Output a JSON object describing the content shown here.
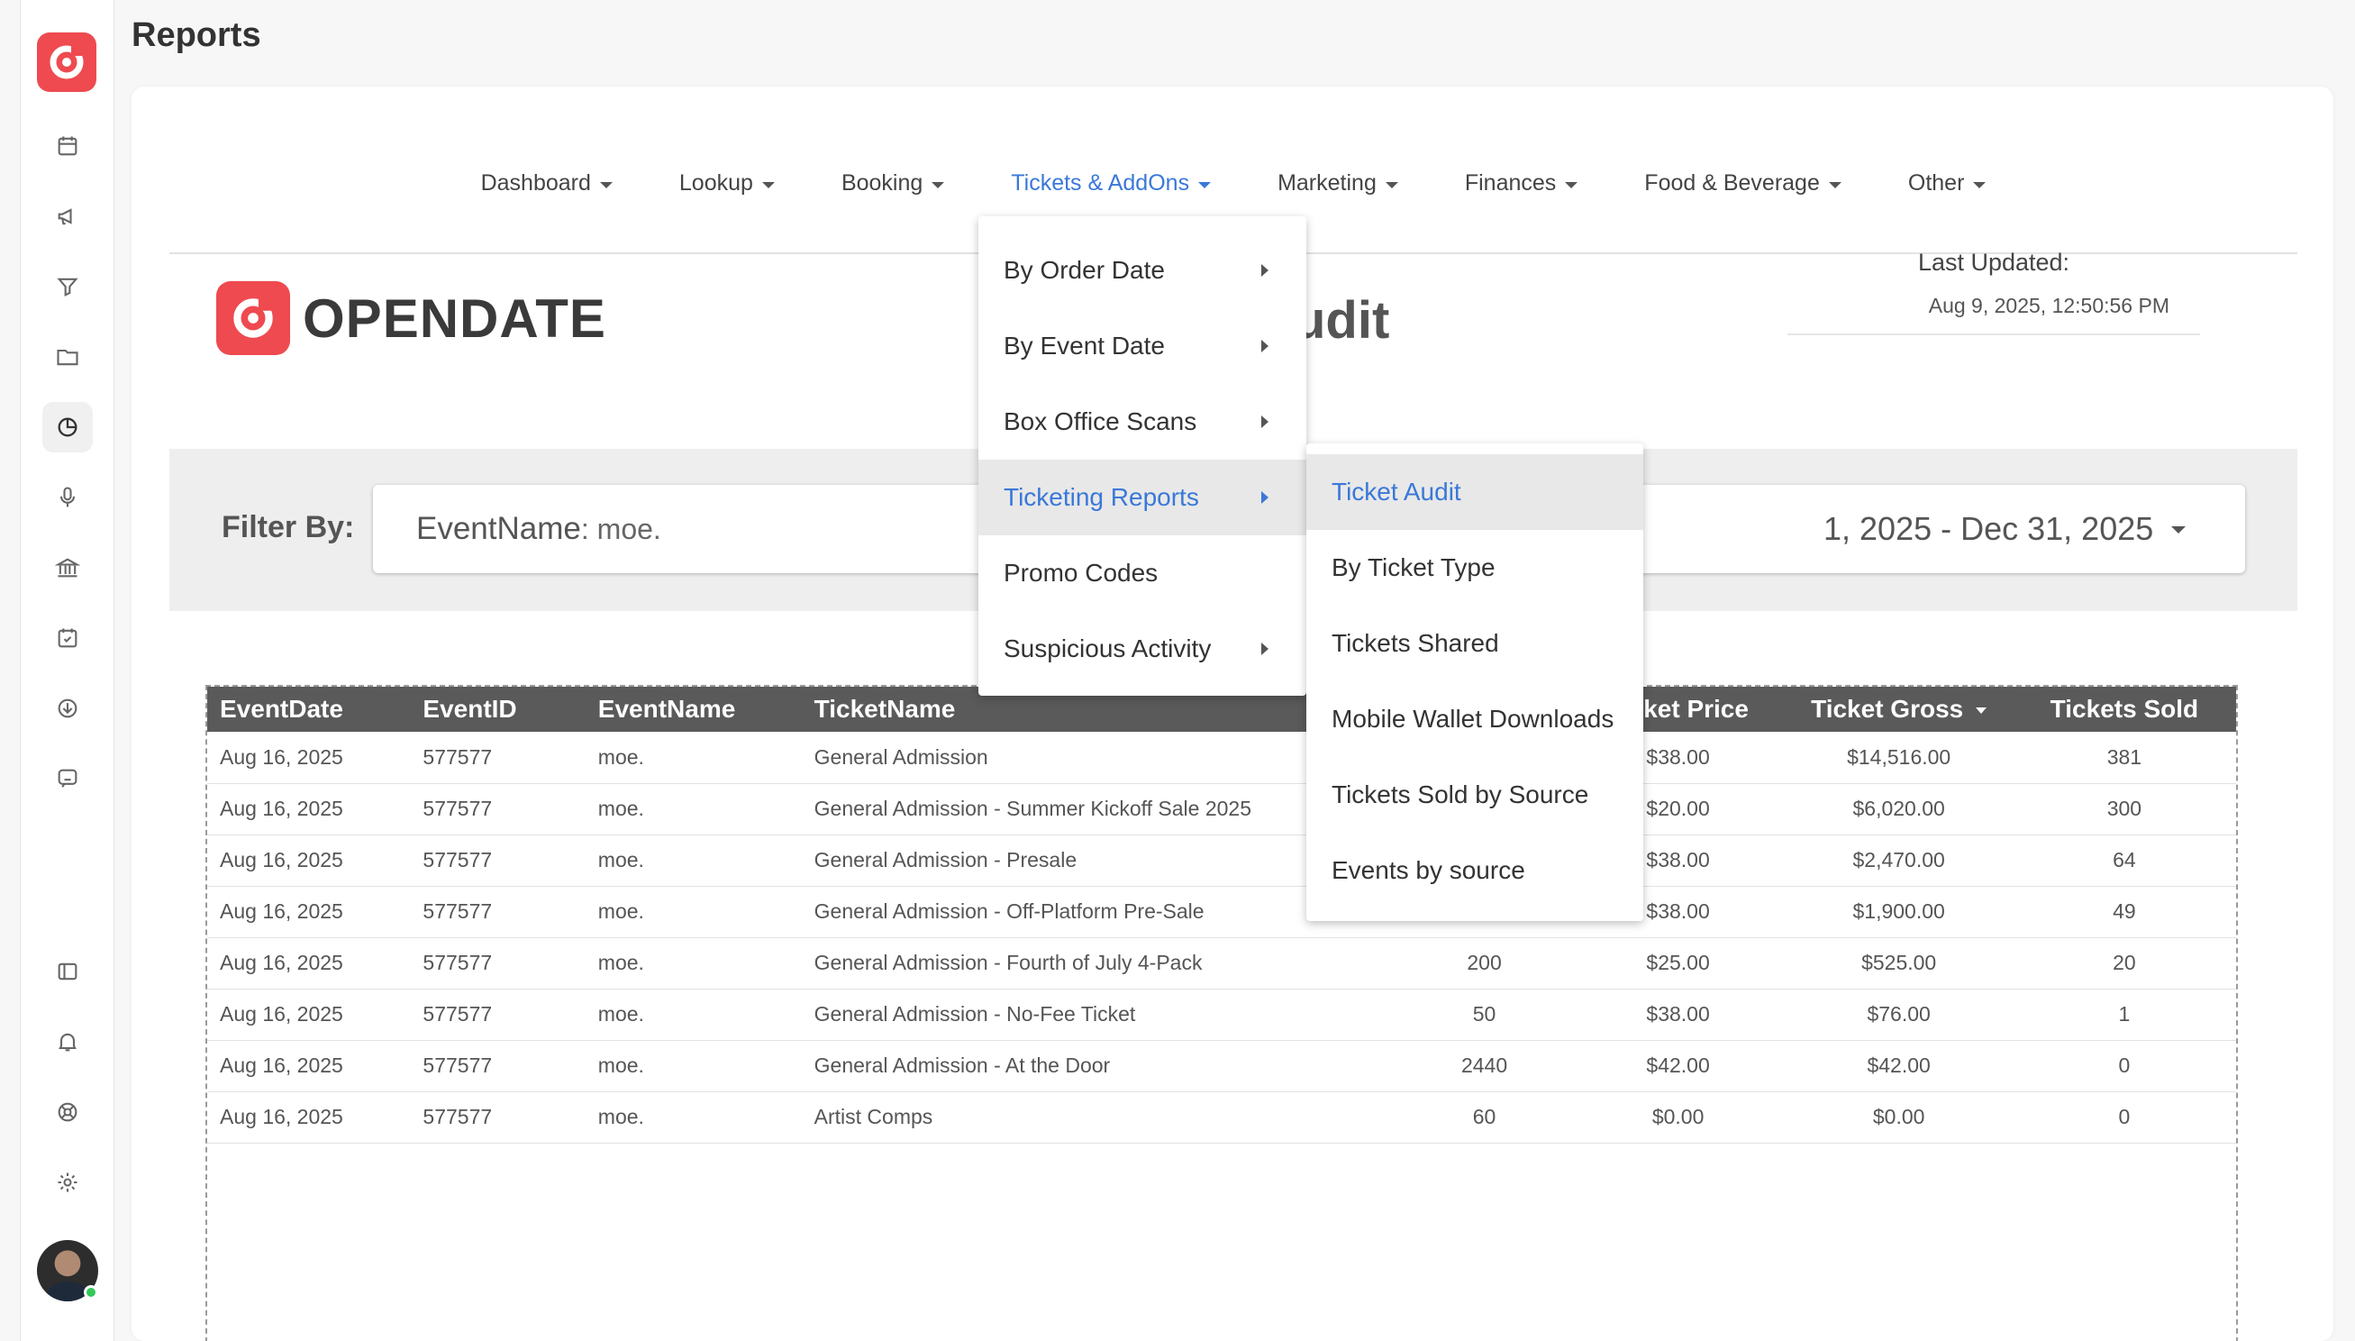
{
  "page": {
    "title": "Reports"
  },
  "rail": {
    "items": [
      "calendar-icon",
      "megaphone-icon",
      "filter-icon",
      "folder-icon",
      "pie-chart-icon",
      "microphone-icon",
      "bank-icon",
      "calendar-check-icon",
      "download-icon",
      "chat-bot-icon",
      "sidebar-toggle-icon",
      "bell-icon",
      "lifebuoy-icon",
      "gear-icon"
    ]
  },
  "nav": {
    "items": [
      {
        "label": "Dashboard"
      },
      {
        "label": "Lookup"
      },
      {
        "label": "Booking"
      },
      {
        "label": "Tickets & AddOns",
        "active": true
      },
      {
        "label": "Marketing"
      },
      {
        "label": "Finances"
      },
      {
        "label": "Food & Beverage"
      },
      {
        "label": "Other"
      }
    ]
  },
  "report": {
    "brand": "OPENDATE",
    "title_visible": "udit",
    "last_updated_label": "Last Updated:",
    "last_updated_value": "Aug 9, 2025, 12:50:56 PM"
  },
  "filter": {
    "label": "Filter By:",
    "field_name": "EventName",
    "field_value": ": moe.",
    "date_range_visible": "1, 2025 - Dec 31, 2025"
  },
  "menu": {
    "items": [
      {
        "label": "By Order Date",
        "has_submenu": true
      },
      {
        "label": "By Event Date",
        "has_submenu": true
      },
      {
        "label": "Box Office Scans",
        "has_submenu": true
      },
      {
        "label": "Ticketing Reports",
        "has_submenu": true,
        "active": true
      },
      {
        "label": "Promo Codes",
        "has_submenu": false
      },
      {
        "label": "Suspicious Activity",
        "has_submenu": true
      }
    ]
  },
  "submenu": {
    "items": [
      {
        "label": "Ticket Audit",
        "active": true
      },
      {
        "label": "By Ticket Type"
      },
      {
        "label": "Tickets Shared"
      },
      {
        "label": "Mobile Wallet Downloads"
      },
      {
        "label": "Tickets Sold by Source"
      },
      {
        "label": "Events by source"
      }
    ]
  },
  "table": {
    "headers": [
      "EventDate",
      "EventID",
      "EventName",
      "TicketName",
      "",
      "Ticket Price",
      "Ticket Gross",
      "Tickets Sold"
    ],
    "rows": [
      [
        "Aug 16, 2025",
        "577577",
        "moe.",
        "General Admission",
        "",
        "$38.00",
        "$14,516.00",
        "381"
      ],
      [
        "Aug 16, 2025",
        "577577",
        "moe.",
        "General Admission - Summer Kickoff Sale 2025",
        "",
        "$20.00",
        "$6,020.00",
        "300"
      ],
      [
        "Aug 16, 2025",
        "577577",
        "moe.",
        "General Admission - Presale",
        "",
        "$38.00",
        "$2,470.00",
        "64"
      ],
      [
        "Aug 16, 2025",
        "577577",
        "moe.",
        "General Admission - Off-Platform Pre-Sale",
        "",
        "$38.00",
        "$1,900.00",
        "49"
      ],
      [
        "Aug 16, 2025",
        "577577",
        "moe.",
        "General Admission - Fourth of July 4-Pack",
        "200",
        "$25.00",
        "$525.00",
        "20"
      ],
      [
        "Aug 16, 2025",
        "577577",
        "moe.",
        "General Admission - No-Fee Ticket",
        "50",
        "$38.00",
        "$76.00",
        "1"
      ],
      [
        "Aug 16, 2025",
        "577577",
        "moe.",
        "General Admission - At the Door",
        "2440",
        "$42.00",
        "$42.00",
        "0"
      ],
      [
        "Aug 16, 2025",
        "577577",
        "moe.",
        "Artist Comps",
        "60",
        "$0.00",
        "$0.00",
        "0"
      ]
    ]
  },
  "colors": {
    "accent": "#3a78d8",
    "brand": "#ee4a50",
    "header_bg": "#5a5a5a"
  }
}
